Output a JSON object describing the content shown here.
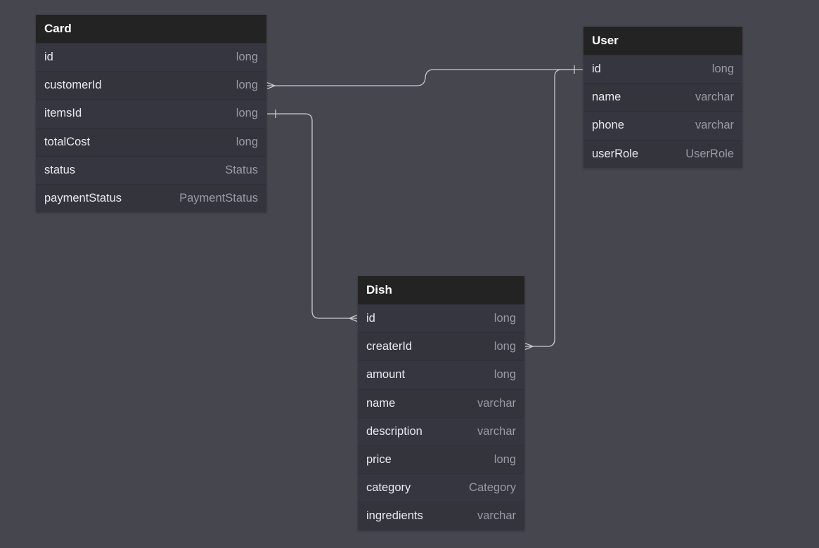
{
  "diagram": {
    "colors": {
      "background": "#46464f",
      "header_background": "#232323",
      "row_background": "#363640",
      "field_name": "#eaeaee",
      "field_type": "#9b9ba5",
      "connector": "#c9c9d0"
    },
    "entities": {
      "card": {
        "title": "Card",
        "fields": [
          {
            "name": "id",
            "type": "long"
          },
          {
            "name": "customerId",
            "type": "long"
          },
          {
            "name": "itemsId",
            "type": "long"
          },
          {
            "name": "totalCost",
            "type": "long"
          },
          {
            "name": "status",
            "type": "Status"
          },
          {
            "name": "paymentStatus",
            "type": "PaymentStatus"
          }
        ]
      },
      "user": {
        "title": "User",
        "fields": [
          {
            "name": "id",
            "type": "long"
          },
          {
            "name": "name",
            "type": "varchar"
          },
          {
            "name": "phone",
            "type": "varchar"
          },
          {
            "name": "userRole",
            "type": "UserRole"
          }
        ]
      },
      "dish": {
        "title": "Dish",
        "fields": [
          {
            "name": "id",
            "type": "long"
          },
          {
            "name": "createrId",
            "type": "long"
          },
          {
            "name": "amount",
            "type": "long"
          },
          {
            "name": "name",
            "type": "varchar"
          },
          {
            "name": "description",
            "type": "varchar"
          },
          {
            "name": "price",
            "type": "long"
          },
          {
            "name": "category",
            "type": "Category"
          },
          {
            "name": "ingredients",
            "type": "varchar"
          }
        ]
      }
    },
    "relations": [
      {
        "from": "Card.customerId",
        "from_end": "many",
        "to": "User.id",
        "to_end": "one"
      },
      {
        "from": "Card.itemsId",
        "from_end": "one",
        "to": "Dish.id",
        "to_end": "many"
      },
      {
        "from": "User.id",
        "from_end": "one",
        "to": "Dish.createrId",
        "to_end": "many"
      }
    ]
  }
}
